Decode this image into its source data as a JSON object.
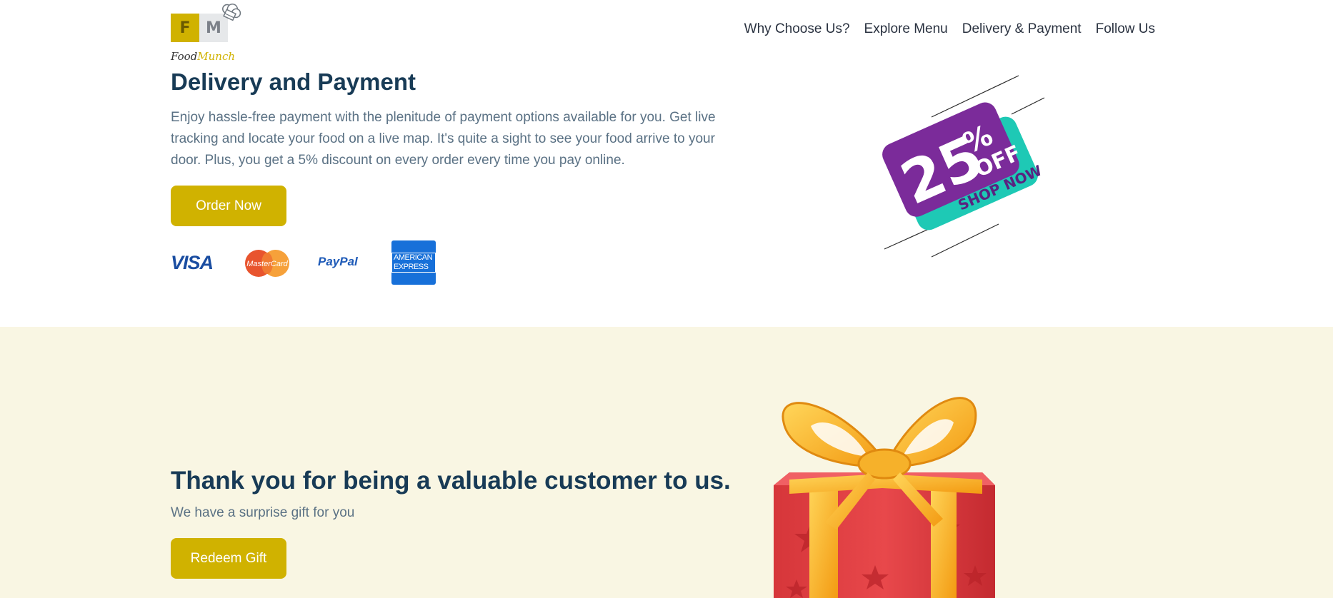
{
  "brand": {
    "logo_letters": [
      "F",
      "M"
    ],
    "name_part1": "Food",
    "name_part2": "Munch"
  },
  "nav": {
    "items": [
      "Why Choose Us?",
      "Explore Menu",
      "Delivery & Payment",
      "Follow Us"
    ]
  },
  "delivery": {
    "title": "Delivery and Payment",
    "description": "Enjoy hassle-free payment with the plenitude of payment options available for you. Get live tracking and locate your food on a live map. It's quite a sight to see your food arrive to your door. Plus, you get a 5% discount on every order every time you pay online.",
    "button": "Order Now",
    "payment_cards": [
      "VISA",
      "MasterCard",
      "PayPal",
      "AMERICAN EXPRESS"
    ]
  },
  "promo": {
    "amount": "25",
    "percent": "%",
    "off": "OFF",
    "cta": "SHOP NOW"
  },
  "gift": {
    "title": "Thank you for being a valuable customer to us.",
    "subtitle": "We have a surprise gift for you",
    "button": "Redeem Gift"
  },
  "colors": {
    "accent": "#d0b200",
    "heading": "#183b56",
    "body_text": "#5a7184",
    "section_bg": "#f9f6e3",
    "promo_purple": "#7b2b9a",
    "promo_teal": "#1ec9b5"
  },
  "icons": [
    "chef-hat-icon",
    "visa-icon",
    "mastercard-icon",
    "paypal-icon",
    "amex-icon"
  ]
}
